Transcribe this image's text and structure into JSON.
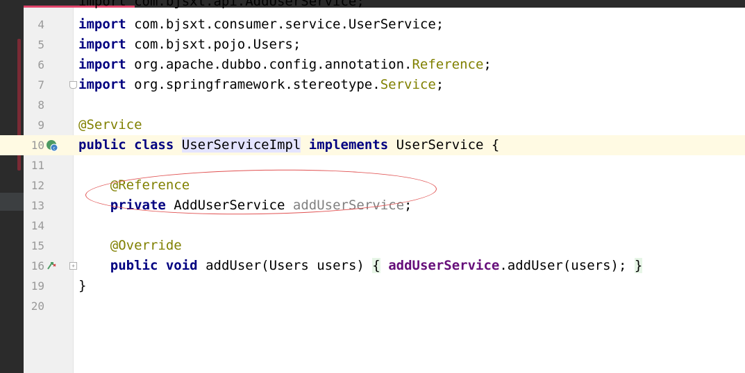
{
  "editor": {
    "cut_line": "import com.bjsxt.api.AddUserService;",
    "lines": [
      {
        "num": "4",
        "tokens": [
          {
            "t": "import",
            "c": "kw"
          },
          {
            "t": " com.bjsxt.consumer.service.UserService;",
            "c": ""
          }
        ]
      },
      {
        "num": "5",
        "tokens": [
          {
            "t": "import",
            "c": "kw"
          },
          {
            "t": " com.bjsxt.pojo.Users;",
            "c": ""
          }
        ]
      },
      {
        "num": "6",
        "tokens": [
          {
            "t": "import",
            "c": "kw"
          },
          {
            "t": " org.apache.dubbo.config.annotation.",
            "c": ""
          },
          {
            "t": "Reference",
            "c": "ann"
          },
          {
            "t": ";",
            "c": ""
          }
        ]
      },
      {
        "num": "7",
        "tokens": [
          {
            "t": "import",
            "c": "kw"
          },
          {
            "t": " org.springframework.stereotype.",
            "c": ""
          },
          {
            "t": "Service",
            "c": "ann"
          },
          {
            "t": ";",
            "c": ""
          }
        ]
      },
      {
        "num": "8",
        "tokens": []
      },
      {
        "num": "9",
        "tokens": [
          {
            "t": "@Service",
            "c": "ann"
          }
        ]
      },
      {
        "num": "10",
        "tokens": [
          {
            "t": "public",
            "c": "kw"
          },
          {
            "t": " ",
            "c": ""
          },
          {
            "t": "class",
            "c": "kw"
          },
          {
            "t": " ",
            "c": ""
          },
          {
            "t": "UserServiceImpl",
            "c": "hl-sel"
          },
          {
            "t": " ",
            "c": ""
          },
          {
            "t": "implements",
            "c": "kw"
          },
          {
            "t": " UserService {",
            "c": ""
          }
        ]
      },
      {
        "num": "11",
        "tokens": []
      },
      {
        "num": "12",
        "tokens": [
          {
            "t": "    ",
            "c": ""
          },
          {
            "t": "@Reference",
            "c": "ann"
          }
        ]
      },
      {
        "num": "13",
        "tokens": [
          {
            "t": "    ",
            "c": ""
          },
          {
            "t": "private",
            "c": "kw"
          },
          {
            "t": " AddUserService ",
            "c": ""
          },
          {
            "t": "addUserService",
            "c": "unused"
          },
          {
            "t": ";",
            "c": ""
          }
        ]
      },
      {
        "num": "14",
        "tokens": []
      },
      {
        "num": "15",
        "tokens": [
          {
            "t": "    ",
            "c": ""
          },
          {
            "t": "@Override",
            "c": "ann"
          }
        ]
      },
      {
        "num": "16",
        "tokens": [
          {
            "t": "    ",
            "c": ""
          },
          {
            "t": "public",
            "c": "kw"
          },
          {
            "t": " ",
            "c": ""
          },
          {
            "t": "void",
            "c": "kw"
          },
          {
            "t": " addUser(Users users) ",
            "c": ""
          },
          {
            "t": "{",
            "c": "brace-hl"
          },
          {
            "t": " ",
            "c": ""
          },
          {
            "t": "addUserService",
            "c": "field"
          },
          {
            "t": ".addUser(users); ",
            "c": ""
          },
          {
            "t": "}",
            "c": "brace-hl"
          }
        ]
      },
      {
        "num": "19",
        "tokens": [
          {
            "t": "}",
            "c": ""
          }
        ]
      },
      {
        "num": "20",
        "tokens": []
      }
    ],
    "current_line": "10",
    "gutter_icons": {
      "line10": "implementation-icon",
      "line16": "override-icon"
    },
    "colors": {
      "keyword": "#000080",
      "annotation": "#808000",
      "field": "#660e7a",
      "unused": "#808080",
      "current_line_bg": "#fffae3",
      "annotation_circle": "#e05050"
    }
  }
}
